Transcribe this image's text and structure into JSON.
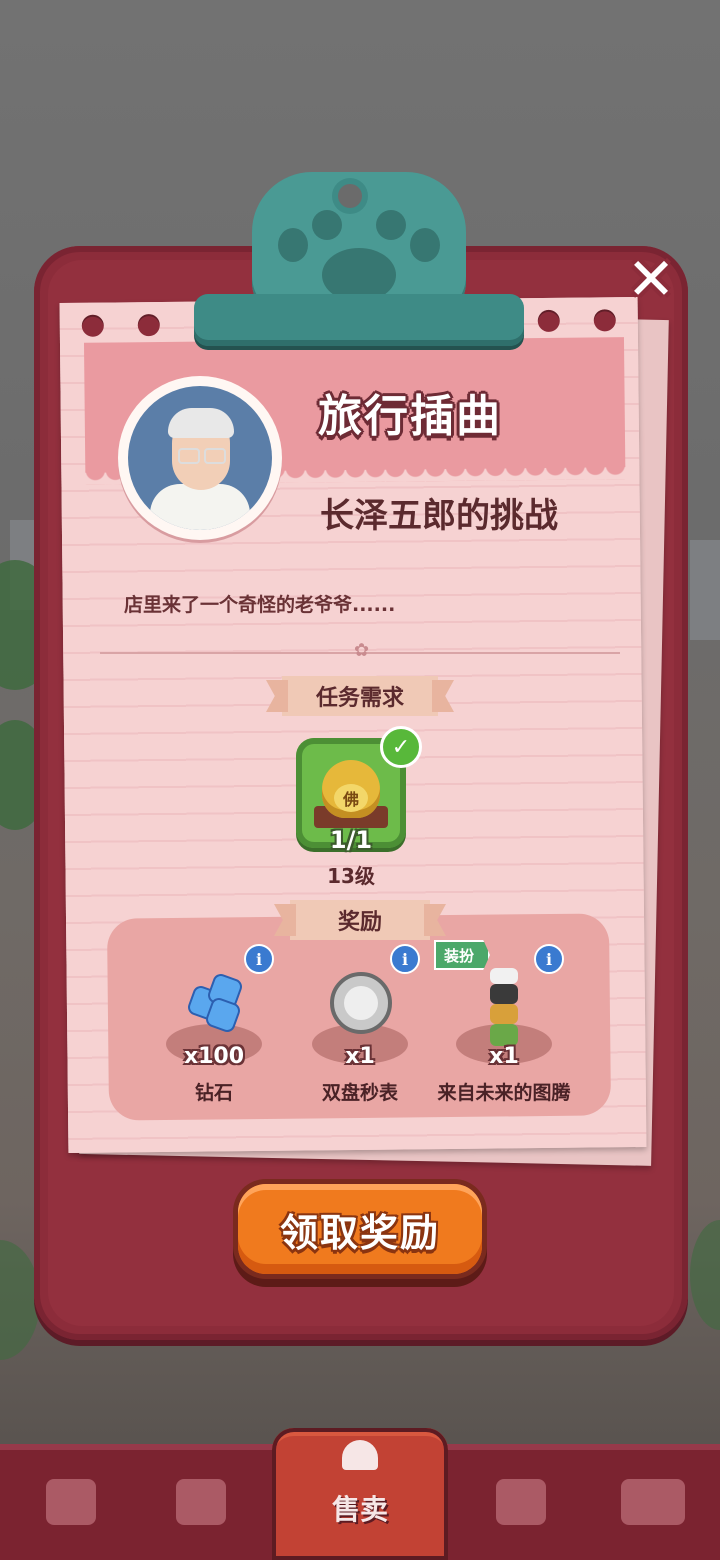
{
  "dialog": {
    "title": "旅行插曲",
    "subtitle": "长泽五郎的挑战",
    "description": "店里来了一个奇怪的老爷爷......",
    "close_icon": "close-icon"
  },
  "task": {
    "header": "任务需求",
    "item_icon": "buddha-pot-icon",
    "item_glyph": "佛",
    "count": "1/1",
    "level": "13级",
    "completed": true
  },
  "rewards": {
    "header": "奖励",
    "items": [
      {
        "icon": "diamond-icon",
        "qty": "x100",
        "name": "钻石"
      },
      {
        "icon": "stopwatch-icon",
        "qty": "x1",
        "name": "双盘秒表"
      },
      {
        "icon": "totem-icon",
        "qty": "x1",
        "name": "来自未来的图腾",
        "badge": "装扮"
      }
    ],
    "info_glyph": "i"
  },
  "claim_button": {
    "label": "领取奖励"
  },
  "bottom_nav": {
    "items": [
      {
        "icon": "bag-icon"
      },
      {
        "icon": "handshake-icon"
      },
      {
        "icon": "bell-icon",
        "label": "售卖",
        "active": true
      },
      {
        "icon": "map-pin-icon"
      },
      {
        "icon": "bus-icon"
      }
    ]
  },
  "colors": {
    "board": "#8c2c3a",
    "paper": "#f6d2d2",
    "clip": "#3e8b86",
    "claim_button": "#f07a1e",
    "nav": "#7b2330"
  }
}
